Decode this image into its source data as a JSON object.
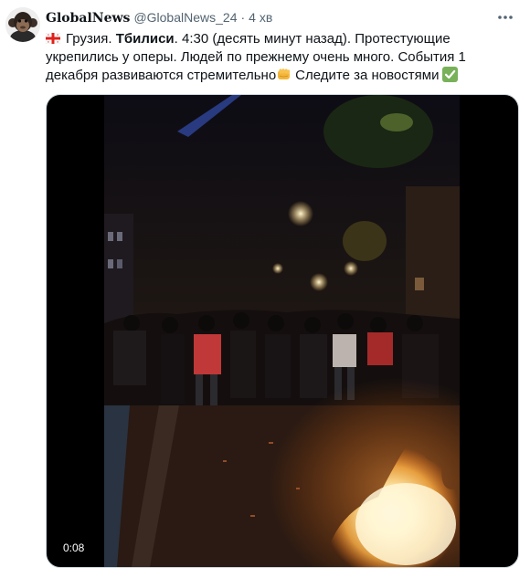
{
  "tweet": {
    "display_name": "GlobalNews",
    "handle": "@GlobalNews_24",
    "separator": "·",
    "time_ago": "4 хв",
    "text": {
      "part_country": "Грузия.",
      "part_city": "Тбилиси",
      "part_line1_rest": ". 4:30 (десять минут назад). Протестующие",
      "part_line2": "укрепились у оперы. Людей по прежнему очень много. События 1",
      "part_line3_a": "декабря развиваются стремительно",
      "part_line3_b": "Следите за новостями"
    },
    "icons": {
      "flag": "georgia-flag-icon",
      "fist": "oncoming-fist-icon",
      "check": "check-mark-icon",
      "more": "more-dots-icon"
    },
    "media": {
      "type": "video",
      "duration": "0:08"
    }
  },
  "colors": {
    "text_primary": "#0f1419",
    "text_secondary": "#536471",
    "border": "#cfd9de",
    "check_green": "#78b159",
    "flag_red": "#e0201b"
  }
}
